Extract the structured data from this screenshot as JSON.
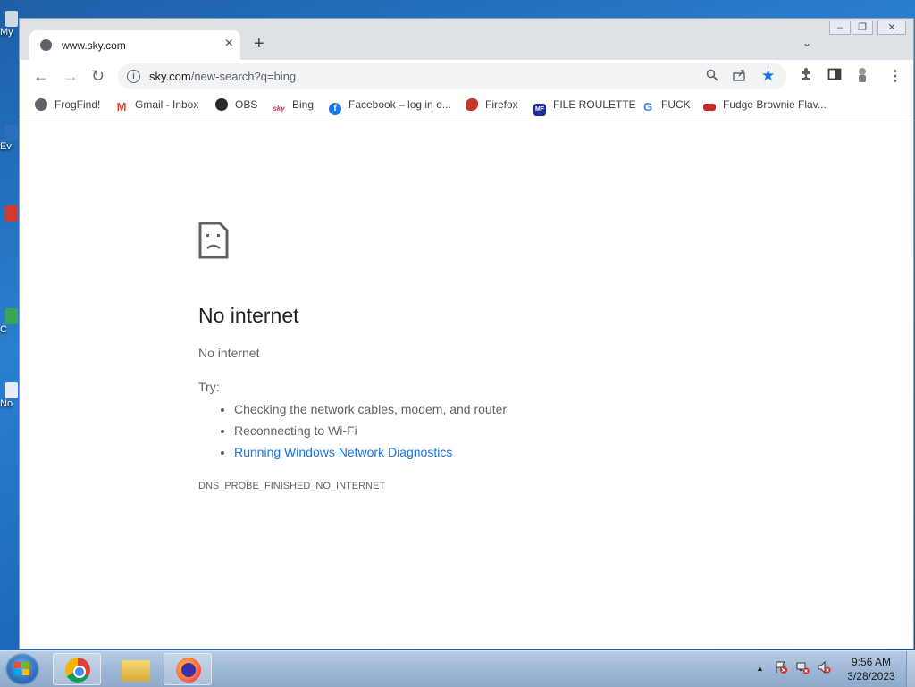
{
  "desktop": {
    "fragments": [
      "My",
      "Ev",
      "C",
      "No"
    ]
  },
  "browser": {
    "tab": {
      "title": "www.sky.com",
      "close_icon": "×"
    },
    "new_tab_icon": "+",
    "tab_search_icon": "⌄",
    "window_controls": {
      "minimize": "–",
      "restore": "❐",
      "close": "✕"
    },
    "nav": {
      "back": "←",
      "forward": "→",
      "reload": "↻"
    },
    "omnibox": {
      "host": "sky.com",
      "path": "/new-search?q=bing"
    },
    "bookmarks": [
      {
        "label": "FrogFind!",
        "icon": "globe-icon",
        "color": "#5f6368"
      },
      {
        "label": "Gmail - Inbox",
        "icon": "gmail-icon",
        "color": "#ea4335"
      },
      {
        "label": "OBS",
        "icon": "github-icon",
        "color": "#24292e"
      },
      {
        "label": "Bing",
        "icon": "sky-icon",
        "color": "#d6336c"
      },
      {
        "label": "Facebook – log in o...",
        "icon": "facebook-icon",
        "color": "#1877f2"
      },
      {
        "label": "Firefox",
        "icon": "firefox-icon",
        "color": "#c0392b"
      },
      {
        "label": "FILE ROULETTE",
        "icon": "file-roulette-icon",
        "color": "#1d2fa0"
      },
      {
        "label": "FUCK",
        "icon": "google-icon",
        "color": "#4285f4"
      },
      {
        "label": "Fudge Brownie Flav...",
        "icon": "fudge-icon",
        "color": "#c62828"
      }
    ]
  },
  "error_page": {
    "title": "No internet",
    "subtitle": "No internet",
    "try_label": "Try:",
    "suggestions": [
      "Checking the network cables, modem, and router",
      "Reconnecting to Wi-Fi"
    ],
    "diagnostics_link": "Running Windows Network Diagnostics",
    "error_code": "DNS_PROBE_FINISHED_NO_INTERNET"
  },
  "taskbar": {
    "time": "9:56 AM",
    "date": "3/28/2023",
    "tray_arrow": "▲"
  },
  "colors": {
    "accent": "#1a73e8",
    "text_secondary": "#5f6368"
  }
}
